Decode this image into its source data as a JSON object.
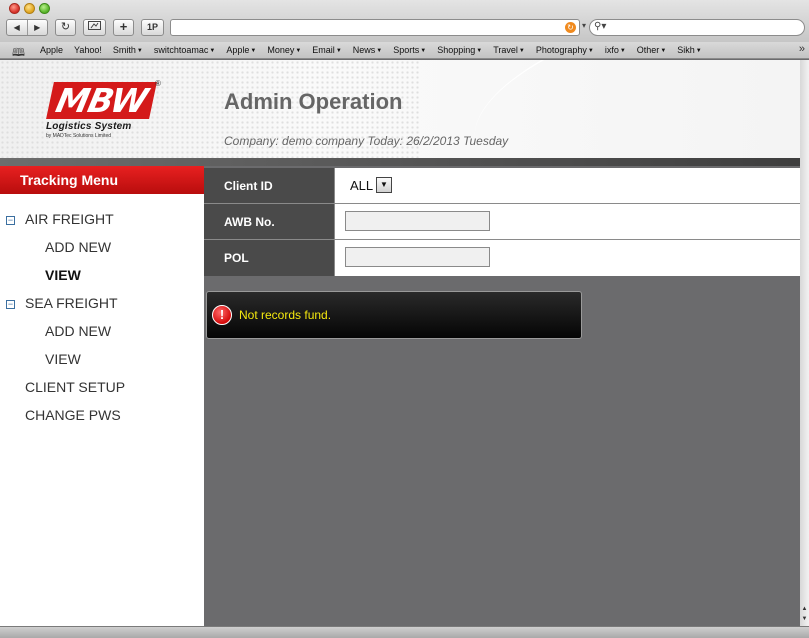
{
  "browser": {
    "nav_back": "◀",
    "nav_forward": "▶",
    "reload": "↻",
    "add": "+",
    "onepassword": "1P",
    "url": "",
    "search_placeholder": "",
    "bookmarks": [
      {
        "label": "Apple",
        "menu": false
      },
      {
        "label": "Yahoo!",
        "menu": false
      },
      {
        "label": "Smith",
        "menu": true
      },
      {
        "label": "switchtoamac",
        "menu": true
      },
      {
        "label": "Apple",
        "menu": true
      },
      {
        "label": "Money",
        "menu": true
      },
      {
        "label": "Email",
        "menu": true
      },
      {
        "label": "News",
        "menu": true
      },
      {
        "label": "Sports",
        "menu": true
      },
      {
        "label": "Shopping",
        "menu": true
      },
      {
        "label": "Travel",
        "menu": true
      },
      {
        "label": "Photography",
        "menu": true
      },
      {
        "label": "ixfo",
        "menu": true
      },
      {
        "label": "Other",
        "menu": true
      },
      {
        "label": "Sikh",
        "menu": true
      }
    ]
  },
  "header": {
    "logo": "MBW",
    "logo_reg": "®",
    "logo_subtitle": "Logistics System",
    "logo_byline": "by MADTec Solutions Limited",
    "title": "Admin Operation",
    "company_info": "Company: demo company Today: 26/2/2013 Tuesday"
  },
  "sidebar": {
    "menu_title": "Tracking Menu",
    "air_freight": "AIR FREIGHT",
    "air_add_new": "ADD NEW",
    "air_view": "VIEW",
    "sea_freight": "SEA FREIGHT",
    "sea_add_new": "ADD NEW",
    "sea_view": "VIEW",
    "client_setup": "CLIENT SETUP",
    "change_pws": "CHANGE PWS",
    "toggle_glyph": "−"
  },
  "form": {
    "client_id_label": "Client ID",
    "client_id_value": "ALL",
    "awb_label": "AWB No.",
    "awb_value": "",
    "pol_label": "POL",
    "pol_value": ""
  },
  "alert": {
    "icon": "!",
    "message": "Not records fund."
  },
  "colors": {
    "accent_red": "#d41a1a",
    "alert_text": "#f5e90e",
    "content_bg": "#6b6b6d"
  }
}
